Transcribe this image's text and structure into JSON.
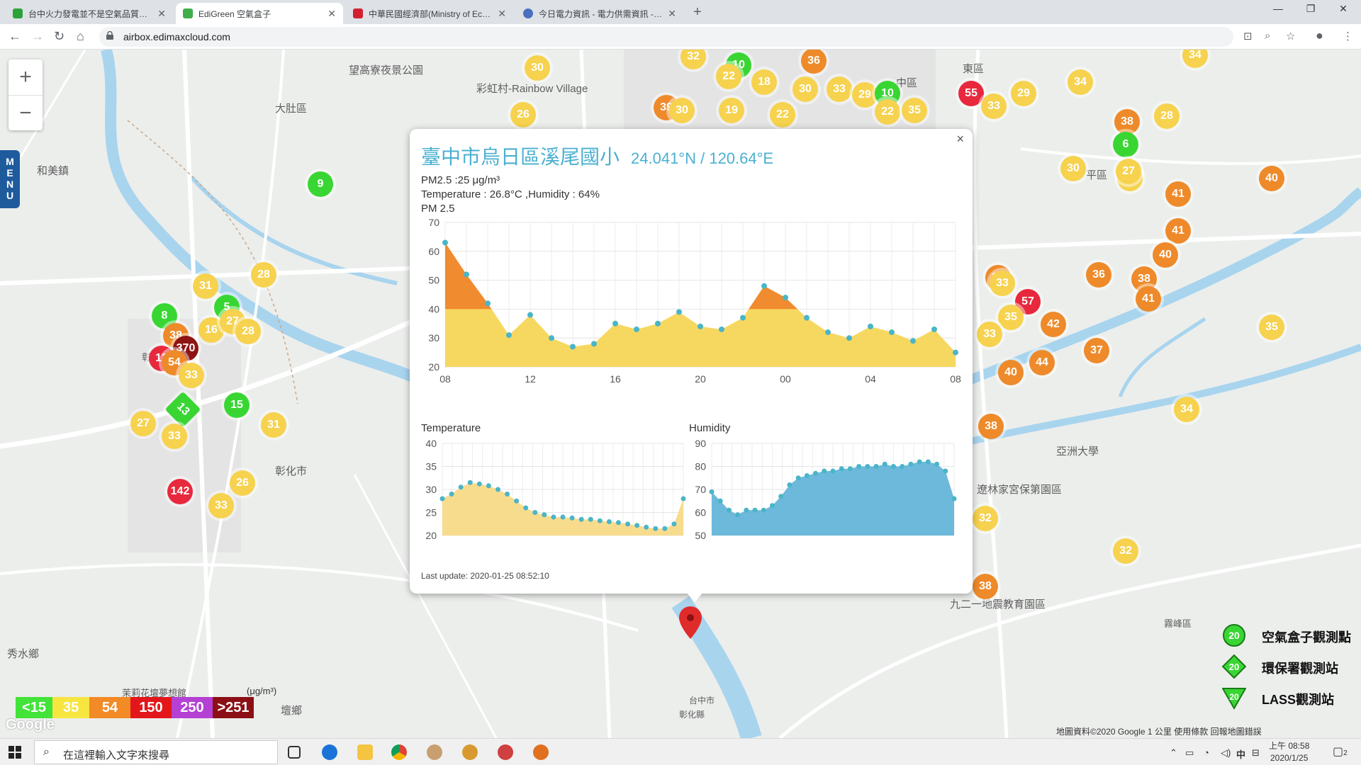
{
  "browser": {
    "tabs": [
      {
        "title": "台中火力發電並不是空氣品質的…",
        "favicon_color": "#2aa33a"
      },
      {
        "title": "EdiGreen 空氣盒子",
        "favicon_color": "#3fae49"
      },
      {
        "title": "中華民國經濟部(Ministry of Eco…",
        "favicon_color": "#d22030"
      },
      {
        "title": "今日電力資訊 - 電力供需資訊 - …",
        "favicon_color": "#4a6fc0"
      }
    ],
    "url": "airbox.edimaxcloud.com"
  },
  "map": {
    "zoom_in": "+",
    "zoom_out": "−",
    "menu_label": [
      "M",
      "E",
      "N",
      "U"
    ],
    "place_labels": [
      {
        "text": "大肚區"
      },
      {
        "text": "和美鎮"
      },
      {
        "text": "彰化市"
      },
      {
        "text": "彰化扇形…"
      },
      {
        "text": "秀水鄉"
      },
      {
        "text": "望高寮夜景公園"
      },
      {
        "text": "彩虹村-Rainbow Village"
      },
      {
        "text": "中區"
      },
      {
        "text": "東區"
      },
      {
        "text": "平區"
      },
      {
        "text": "九二一地震教育園區"
      },
      {
        "text": "霧峰區"
      },
      {
        "text": "亞洲大學"
      },
      {
        "text": "遼林家宮保第園區"
      },
      {
        "text": "壇鄉"
      },
      {
        "text": "茉莉花壇夢想館"
      },
      {
        "text": "台中市"
      },
      {
        "text": "彰化縣"
      }
    ],
    "markers": [
      {
        "v": "32",
        "c": "y"
      },
      {
        "v": "10",
        "c": "g"
      },
      {
        "v": "22",
        "c": "y"
      },
      {
        "v": "18",
        "c": "y"
      },
      {
        "v": "36",
        "c": "o"
      },
      {
        "v": "30",
        "c": "y"
      },
      {
        "v": "33",
        "c": "y"
      },
      {
        "v": "29",
        "c": "y"
      },
      {
        "v": "10",
        "c": "g"
      },
      {
        "v": "55",
        "c": "r"
      },
      {
        "v": "29",
        "c": "y"
      },
      {
        "v": "34",
        "c": "y"
      },
      {
        "v": "34",
        "c": "y"
      },
      {
        "v": "30",
        "c": "y"
      },
      {
        "v": "26",
        "c": "y"
      },
      {
        "v": "39",
        "c": "o"
      },
      {
        "v": "30",
        "c": "y"
      },
      {
        "v": "19",
        "c": "y"
      },
      {
        "v": "22",
        "c": "y"
      },
      {
        "v": "22",
        "c": "y"
      },
      {
        "v": "35",
        "c": "y"
      },
      {
        "v": "33",
        "c": "y"
      },
      {
        "v": "38",
        "c": "o"
      },
      {
        "v": "28",
        "c": "y"
      },
      {
        "v": "6",
        "c": "g"
      },
      {
        "v": "33",
        "c": "y"
      },
      {
        "v": "9",
        "c": "g"
      },
      {
        "v": "30",
        "c": "y"
      },
      {
        "v": "27",
        "c": "y"
      },
      {
        "v": "40",
        "c": "o"
      },
      {
        "v": "41",
        "c": "o"
      },
      {
        "v": "41",
        "c": "o"
      },
      {
        "v": "40",
        "c": "o"
      },
      {
        "v": "28",
        "c": "y"
      },
      {
        "v": "37",
        "c": "o"
      },
      {
        "v": "38",
        "c": "o"
      },
      {
        "v": "31",
        "c": "y"
      },
      {
        "v": "8",
        "c": "g"
      },
      {
        "v": "5",
        "c": "g"
      },
      {
        "v": "38",
        "c": "o"
      },
      {
        "v": "16",
        "c": "y"
      },
      {
        "v": "27",
        "c": "y"
      },
      {
        "v": "28",
        "c": "y"
      },
      {
        "v": "370",
        "c": "d"
      },
      {
        "v": "12",
        "c": "r"
      },
      {
        "v": "54",
        "c": "o"
      },
      {
        "v": "33",
        "c": "y"
      },
      {
        "v": "36",
        "c": "o"
      },
      {
        "v": "33",
        "c": "y"
      },
      {
        "v": "57",
        "c": "r"
      },
      {
        "v": "35",
        "c": "y"
      },
      {
        "v": "42",
        "c": "o"
      },
      {
        "v": "41",
        "c": "o"
      },
      {
        "v": "35",
        "c": "y"
      },
      {
        "v": "33",
        "c": "y"
      },
      {
        "v": "37",
        "c": "o"
      },
      {
        "v": "40",
        "c": "o"
      },
      {
        "v": "44",
        "c": "o"
      },
      {
        "v": "13",
        "c": "g"
      },
      {
        "v": "15",
        "c": "g"
      },
      {
        "v": "27",
        "c": "y"
      },
      {
        "v": "33",
        "c": "y"
      },
      {
        "v": "31",
        "c": "y"
      },
      {
        "v": "34",
        "c": "y"
      },
      {
        "v": "38",
        "c": "o"
      },
      {
        "v": "26",
        "c": "y"
      },
      {
        "v": "142",
        "c": "r"
      },
      {
        "v": "33",
        "c": "y"
      },
      {
        "v": "32",
        "c": "y"
      },
      {
        "v": "32",
        "c": "y"
      },
      {
        "v": "28",
        "c": "y"
      },
      {
        "v": "37",
        "c": "o"
      },
      {
        "v": "38",
        "c": "o"
      },
      {
        "v": "25",
        "c": "y"
      }
    ]
  },
  "popup": {
    "title": "臺中市烏日區溪尾國小",
    "coords": "24.041°N / 120.64°E",
    "pm25_line": "PM2.5 :25 μg/m³",
    "temp_hum_line": "Temperature : 26.8°C ,Humidity : 64%",
    "pm_label": "PM 2.5",
    "temp_label": "Temperature",
    "hum_label": "Humidity",
    "last_update": "Last update: 2020-01-25 08:52:10",
    "close": "×"
  },
  "chart_data": [
    {
      "type": "area",
      "title": "PM 2.5",
      "ylim": [
        20,
        70
      ],
      "yticks": [
        20,
        30,
        40,
        50,
        60,
        70
      ],
      "xticks": [
        "08",
        "12",
        "16",
        "20",
        "00",
        "04",
        "08"
      ],
      "threshold": 40,
      "colors": {
        "low": "#f6d860",
        "high": "#f08b30",
        "dot": "#4ab5c8"
      },
      "values": [
        63,
        52,
        42,
        31,
        38,
        30,
        27,
        28,
        35,
        33,
        35,
        39,
        34,
        33,
        37,
        48,
        44,
        37,
        32,
        30,
        34,
        32,
        29,
        33,
        25
      ]
    },
    {
      "type": "area",
      "title": "Temperature",
      "ylim": [
        20,
        40
      ],
      "yticks": [
        20,
        25,
        30,
        35,
        40
      ],
      "colors": {
        "fill": "#f8dc8e",
        "dot": "#4ab5c8"
      },
      "values": [
        28,
        29,
        30.5,
        31.5,
        31.2,
        30.8,
        30,
        29,
        27.5,
        26,
        25,
        24.5,
        24,
        24,
        23.8,
        23.5,
        23.5,
        23.2,
        23,
        22.8,
        22.5,
        22.2,
        21.8,
        21.5,
        21.5,
        22.5,
        28
      ]
    },
    {
      "type": "area",
      "title": "Humidity",
      "ylim": [
        50,
        90
      ],
      "yticks": [
        50,
        60,
        70,
        80,
        90
      ],
      "colors": {
        "fill": "#6db9dc",
        "dot": "#4ab5c8"
      },
      "values": [
        69,
        65,
        61,
        59,
        61,
        61,
        61,
        63,
        67,
        72,
        75,
        76,
        77,
        78,
        78,
        79,
        79,
        80,
        80,
        80,
        81,
        80,
        80,
        81,
        82,
        82,
        81,
        78,
        66
      ]
    }
  ],
  "legend": {
    "scale": [
      {
        "label": "<15",
        "color": "#43e33a"
      },
      {
        "label": "35",
        "color": "#f7e540"
      },
      {
        "label": "54",
        "color": "#f28a26"
      },
      {
        "label": "150",
        "color": "#e3161b"
      },
      {
        "label": "250",
        "color": "#b440d4"
      },
      {
        "label": ">251",
        "color": "#8c0f16"
      }
    ],
    "unit": "(μg/m³)",
    "stations": [
      {
        "label": "空氣盒子觀測點",
        "value": "20",
        "shape": "circle"
      },
      {
        "label": "環保署觀測站",
        "value": "20",
        "shape": "diamond"
      },
      {
        "label": "LASS觀測站",
        "value": "20",
        "shape": "triangle"
      }
    ],
    "footer": "地圖資料©2020 Google    1 公里            使用條款    回報地圖錯誤",
    "google": "Google"
  },
  "taskbar": {
    "search_placeholder": "在這裡輸入文字來搜尋",
    "time": "上午 08:58",
    "date": "2020/1/25",
    "ime": "中",
    "notif": "2"
  }
}
